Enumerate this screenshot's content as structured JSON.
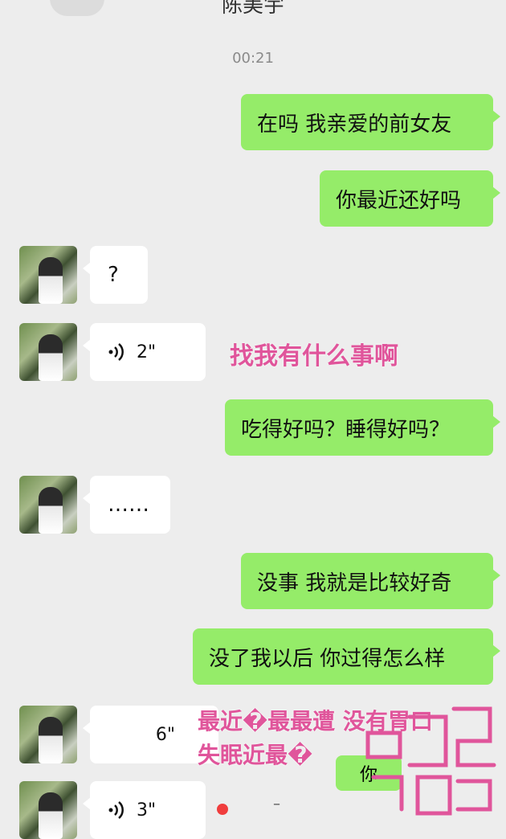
{
  "header": {
    "title": "陈美宇"
  },
  "timestamp": "00:21",
  "messages": [
    {
      "side": "sent",
      "text": "在吗 我亲爱的前女友"
    },
    {
      "side": "sent",
      "text": "你最近还好吗"
    },
    {
      "side": "recv",
      "text": "?"
    },
    {
      "side": "recv",
      "type": "voice",
      "duration": "2\""
    },
    {
      "side": "sent",
      "text": "吃得好吗？睡得好吗？"
    },
    {
      "side": "recv",
      "text": "……"
    },
    {
      "side": "sent",
      "text": "没事 我就是比较好奇"
    },
    {
      "side": "sent",
      "text": "没了我以后 你过得怎么样"
    },
    {
      "side": "recv",
      "type": "voice",
      "duration": "6\""
    },
    {
      "side": "recv",
      "type": "voice",
      "duration": "3\""
    }
  ],
  "annotations": {
    "voice1_caption": "找我有什么事啊",
    "voice2_caption_line1": "最近�最最遭 没有胃口",
    "voice2_caption_line2": "失眠近最�",
    "partial_bubble": "你"
  },
  "colors": {
    "background": "#ededed",
    "sent_bubble": "#95ec69",
    "recv_bubble": "#ffffff",
    "caption": "#e0559b",
    "record_dot": "#f03d3d"
  },
  "icons": [
    "back-arrow-icon",
    "voice-wave-icon",
    "recording-dot-icon"
  ]
}
